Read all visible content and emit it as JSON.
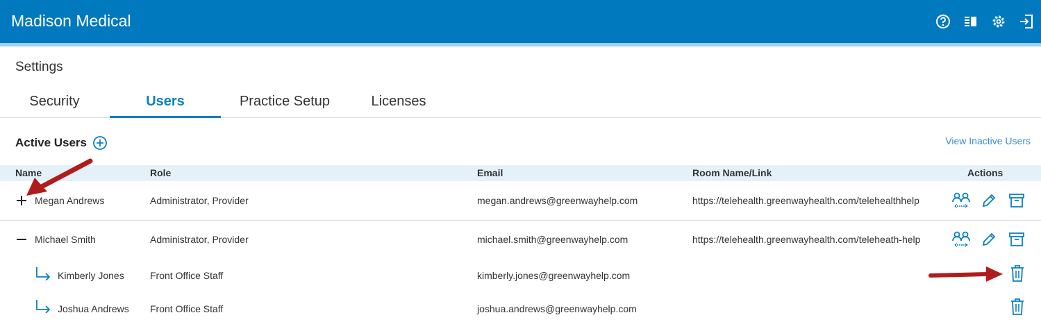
{
  "app": {
    "title": "Madison Medical",
    "icons": [
      "help-icon",
      "panel-icon",
      "gear-icon",
      "logout-icon"
    ],
    "brand_color": "#0079bf"
  },
  "page": {
    "title": "Settings"
  },
  "tabs": [
    {
      "label": "Security",
      "active": false
    },
    {
      "label": "Users",
      "active": true
    },
    {
      "label": "Practice Setup",
      "active": false
    },
    {
      "label": "Licenses",
      "active": false
    }
  ],
  "section": {
    "title": "Active Users",
    "view_inactive_label": "View Inactive Users"
  },
  "table": {
    "columns": [
      "Name",
      "Role",
      "Email",
      "Room Name/Link",
      "Actions"
    ],
    "rows": [
      {
        "name": "Megan Andrews",
        "role": "Administrator, Provider",
        "email": "megan.andrews@greenwayhelp.com",
        "room": "https://telehealth.greenwayhealth.com/telehealthhelp",
        "expander": "+",
        "level": 0
      },
      {
        "name": "Michael Smith",
        "role": "Administrator, Provider",
        "email": "michael.smith@greenwayhelp.com",
        "room": "https://telehealth.greenwayhealth.com/teleheath-help",
        "expander": "−",
        "level": 0
      },
      {
        "name": "Kimberly Jones",
        "role": "Front Office Staff",
        "email": "kimberly.jones@greenwayhelp.com",
        "room": "",
        "level": 1
      },
      {
        "name": "Joshua Andrews",
        "role": "Front Office Staff",
        "email": "joshua.andrews@greenwayhelp.com",
        "room": "",
        "level": 1
      }
    ]
  },
  "colors": {
    "accent": "#0a7fc3",
    "annotation": "#b01c1c",
    "header_bg": "#e4f1f9"
  }
}
